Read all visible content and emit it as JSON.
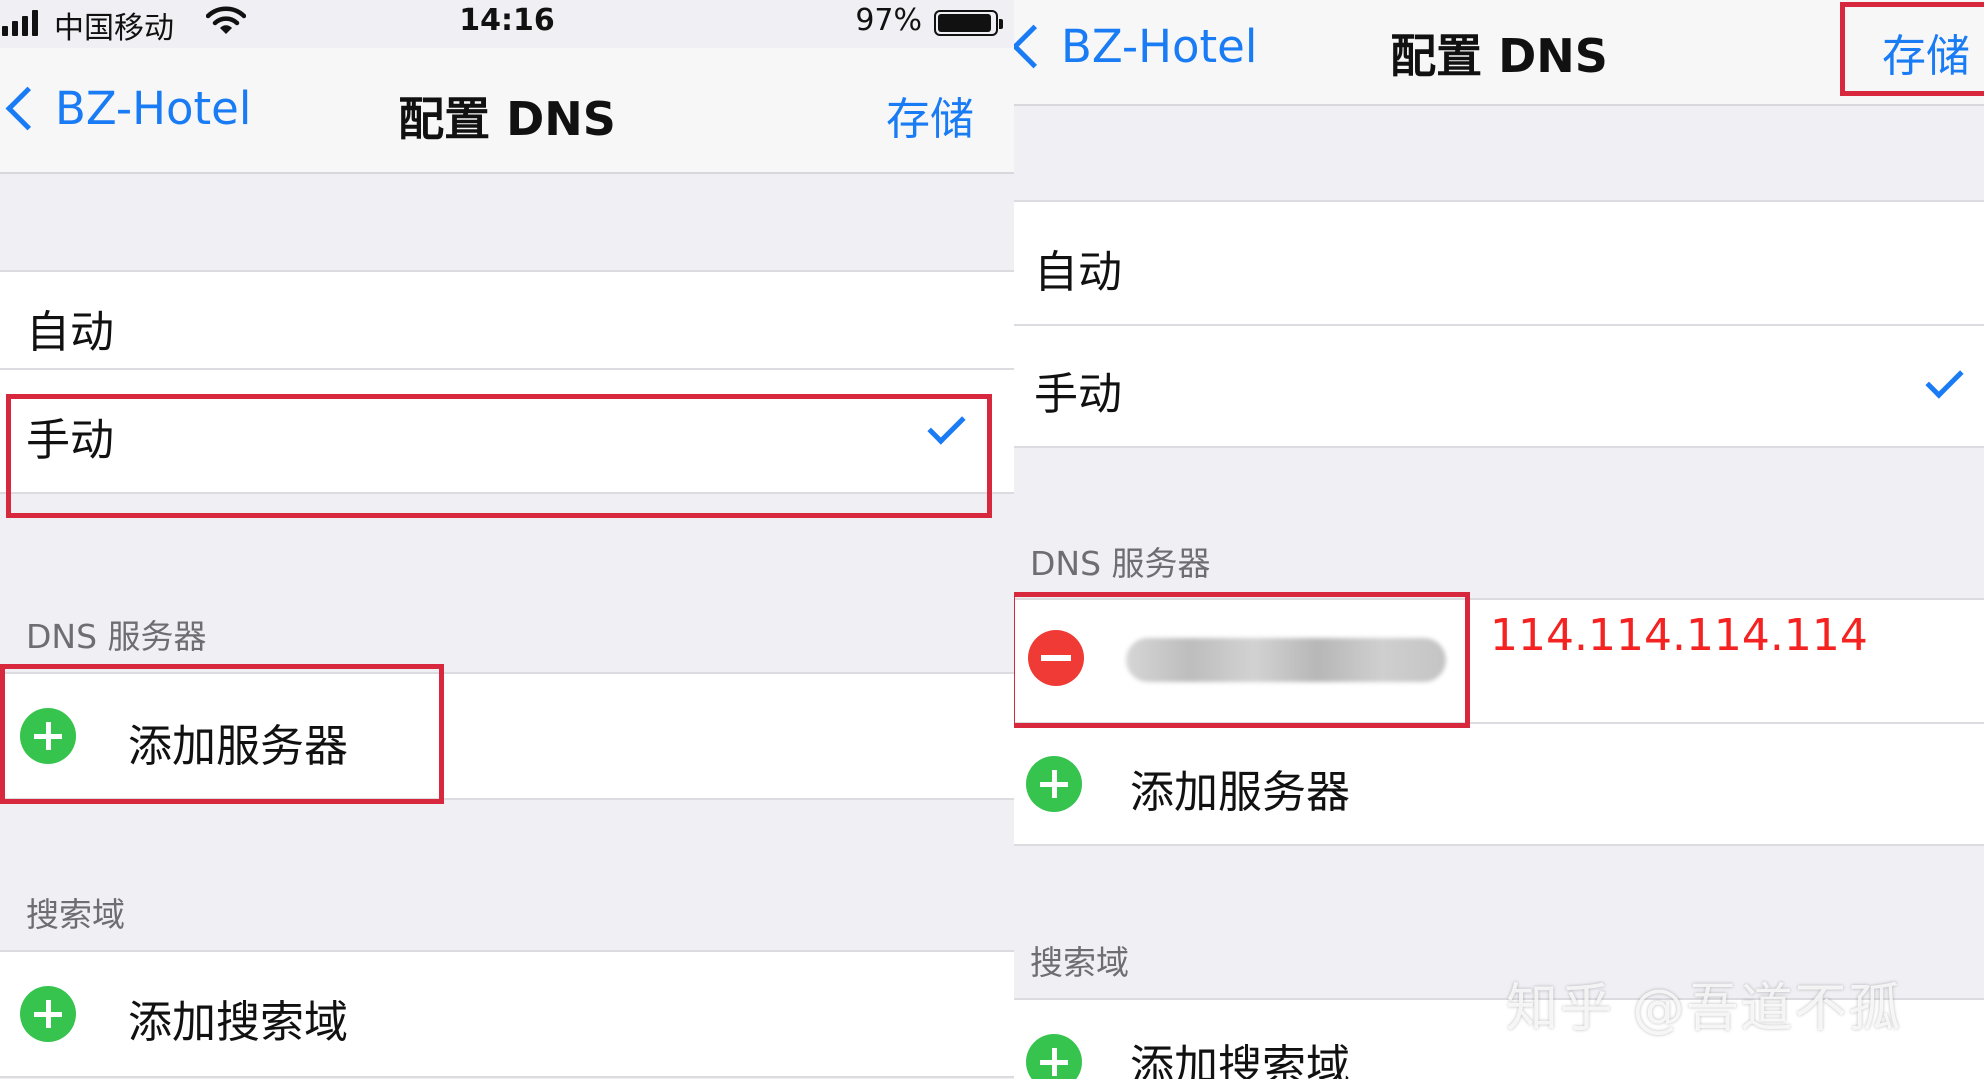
{
  "colors": {
    "accent": "#1a7cf5",
    "add": "#36c44e",
    "remove": "#f03a36",
    "highlight": "#d8283e",
    "annotation": "#f52222"
  },
  "left": {
    "status_bar": {
      "carrier": "中国移动",
      "time": "14:16",
      "battery": "97%"
    },
    "nav": {
      "back_label": "BZ-Hotel",
      "title": "配置 DNS",
      "save_label": "存储"
    },
    "options": [
      {
        "label": "自动"
      },
      {
        "label": "手动",
        "selected": true
      }
    ],
    "dns_section": {
      "header": "DNS 服务器",
      "add_label": "添加服务器"
    },
    "search_section": {
      "header": "搜索域",
      "add_label": "添加搜索域"
    }
  },
  "right": {
    "nav": {
      "back_label": "BZ-Hotel",
      "title": "配置 DNS",
      "save_label": "存储"
    },
    "options": [
      {
        "label": "自动"
      },
      {
        "label": "手动",
        "selected": true
      }
    ],
    "dns_section": {
      "header": "DNS 服务器",
      "server_value_annotation": "114.114.114.114",
      "add_label": "添加服务器"
    },
    "search_section": {
      "header": "搜索域",
      "add_label": "添加搜索域"
    }
  },
  "watermark": "知乎 @吾道不孤"
}
